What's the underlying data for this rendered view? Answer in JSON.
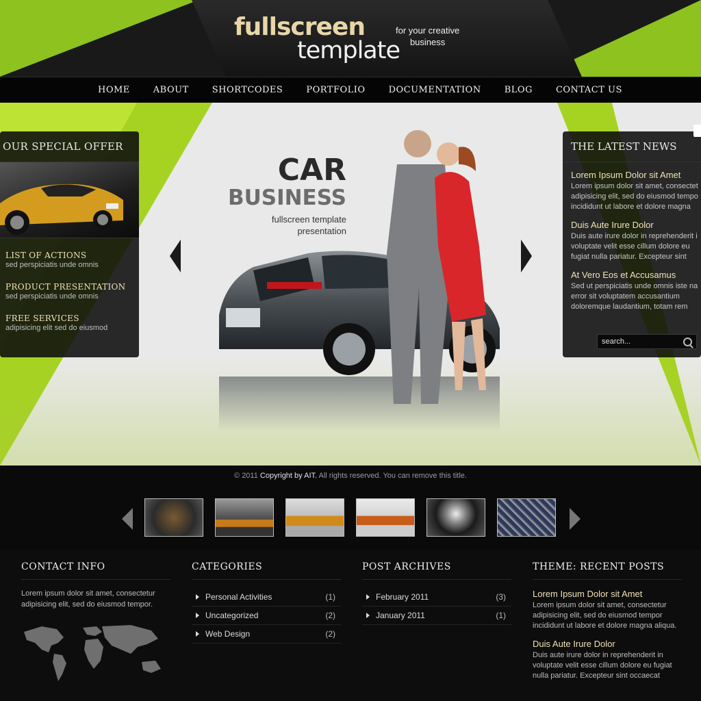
{
  "header": {
    "logo_line1": "fullscreen",
    "logo_line2": "template",
    "tagline_line1": "for your creative",
    "tagline_line2": "business"
  },
  "nav": {
    "items": [
      "HOME",
      "ABOUT",
      "SHORTCODES",
      "PORTFOLIO",
      "DOCUMENTATION",
      "BLOG",
      "CONTACT US"
    ]
  },
  "hero": {
    "title_line1": "CAR",
    "title_line2": "BUSINESS",
    "subtitle_line1": "fullscreen template",
    "subtitle_line2": "presentation"
  },
  "offer": {
    "heading": "OUR SPECIAL OFFER",
    "items": [
      {
        "title": "LIST OF ACTIONS",
        "text": "sed perspiciatis unde omnis"
      },
      {
        "title": "PRODUCT PRESENTATION",
        "text": "sed perspiciatis unde omnis"
      },
      {
        "title": "FREE SERVICES",
        "text": "adipisicing elit sed do eiusmod"
      }
    ]
  },
  "news": {
    "heading": "THE LATEST NEWS",
    "items": [
      {
        "title": "Lorem Ipsum Dolor sit Amet",
        "lines": [
          "Lorem ipsum dolor sit amet, consectet",
          "adipisicing elit, sed do eiusmod tempo",
          "incididunt ut labore et dolore magna"
        ]
      },
      {
        "title": "Duis Aute Irure Dolor",
        "lines": [
          "Duis aute irure dolor in reprehenderit i",
          "voluptate velit esse cillum dolore eu",
          "fugiat nulla pariatur. Excepteur sint"
        ]
      },
      {
        "title": "At Vero Eos et Accusamus",
        "lines": [
          "Sed ut perspiciatis unde omnis iste na",
          "error sit voluptatem accusantium",
          "doloremque laudantium, totam rem"
        ]
      }
    ],
    "search_placeholder": "search..."
  },
  "copyright": {
    "prefix": "© 2011 ",
    "strong": "Copyright by AIT.",
    "suffix": " All rights reserved. You can remove this title."
  },
  "footer": {
    "contact": {
      "heading": "CONTACT INFO",
      "text": "Lorem ipsum dolor sit amet, consectetur adipisicing elit, sed do eiusmod tempor."
    },
    "categories": {
      "heading": "CATEGORIES",
      "items": [
        {
          "label": "Personal Activities",
          "count": "(1)"
        },
        {
          "label": "Uncategorized",
          "count": "(2)"
        },
        {
          "label": "Web Design",
          "count": "(2)"
        }
      ]
    },
    "archives": {
      "heading": "POST ARCHIVES",
      "items": [
        {
          "label": "February 2011",
          "count": "(3)"
        },
        {
          "label": "January 2011",
          "count": "(1)"
        }
      ]
    },
    "recent": {
      "heading": "THEME: RECENT POSTS",
      "items": [
        {
          "title": "Lorem Ipsum Dolor sit Amet",
          "text": "Lorem ipsum dolor sit amet, consectetur adipisicing elit, sed do eiusmod tempor incididunt ut labore et dolore magna aliqua."
        },
        {
          "title": "Duis Aute Irure Dolor",
          "text": "Duis aute irure dolor in reprehenderit in voluptate velit esse cillum dolore eu fugiat nulla pariatur. Excepteur sint occaecat"
        }
      ]
    }
  },
  "colors": {
    "accent_green": "#a6d322",
    "dark": "#0b0b0b",
    "gold_text": "#f0e2b5"
  }
}
